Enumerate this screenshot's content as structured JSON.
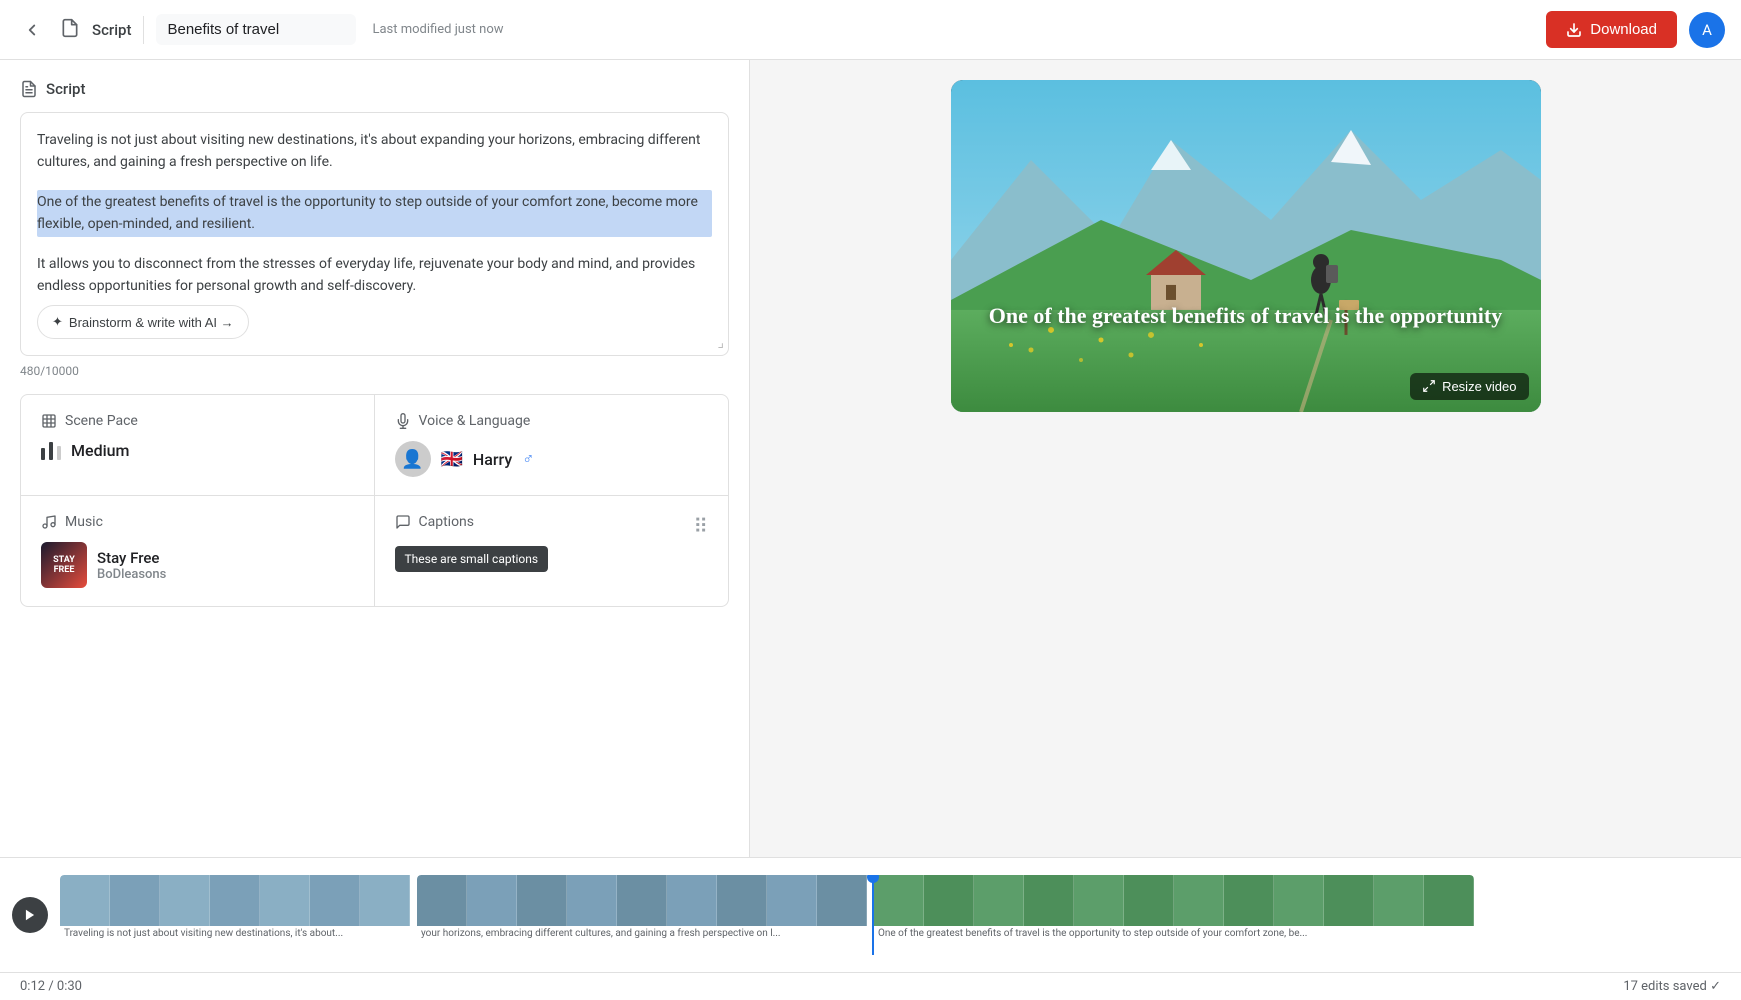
{
  "topbar": {
    "back_label": "←",
    "doc_icon": "📄",
    "script_label": "Script",
    "title_value": "Benefits of travel",
    "title_placeholder": "Benefits of travel",
    "modified_text": "Last modified just now",
    "download_label": "Download",
    "avatar_label": "A"
  },
  "left_panel": {
    "section_title": "Script",
    "script_para1": "Traveling is not just about visiting new destinations, it's about expanding your horizons, embracing different cultures, and gaining a fresh perspective on life.",
    "script_para2_highlighted": "One of the greatest benefits of travel is the opportunity to step outside of your comfort zone, become more flexible, open-minded, and resilient.",
    "script_para3": "It allows you to disconnect from the stresses of everyday life, rejuvenate your body and mind, and provides endless opportunities for personal growth and self-discovery.",
    "brainstorm_label": "Brainstorm & write with AI →",
    "char_count": "480/10000",
    "scene_pace": {
      "title": "Scene Pace",
      "value": "Medium"
    },
    "voice_language": {
      "title": "Voice & Language",
      "name": "Harry",
      "flag": "🇬🇧",
      "gender": "♂"
    },
    "music": {
      "title": "Music",
      "track": "Stay Free",
      "artist": "BoDleasons"
    },
    "captions": {
      "title": "Captions",
      "tooltip": "These are small captions"
    }
  },
  "video_preview": {
    "caption_text": "One of the greatest benefits of travel is the opportunity",
    "resize_label": "Resize video"
  },
  "timeline": {
    "time_current": "0:12",
    "time_total": "0:30",
    "text1": "Traveling is not just about visiting new destinations, it's about...",
    "text2": "your horizons, embracing different cultures, and gaining a fresh perspective on l...",
    "text3": "One of the greatest benefits of travel is the opportunity to step outside of your comfort zone, be...",
    "edits_saved": "17 edits saved"
  }
}
